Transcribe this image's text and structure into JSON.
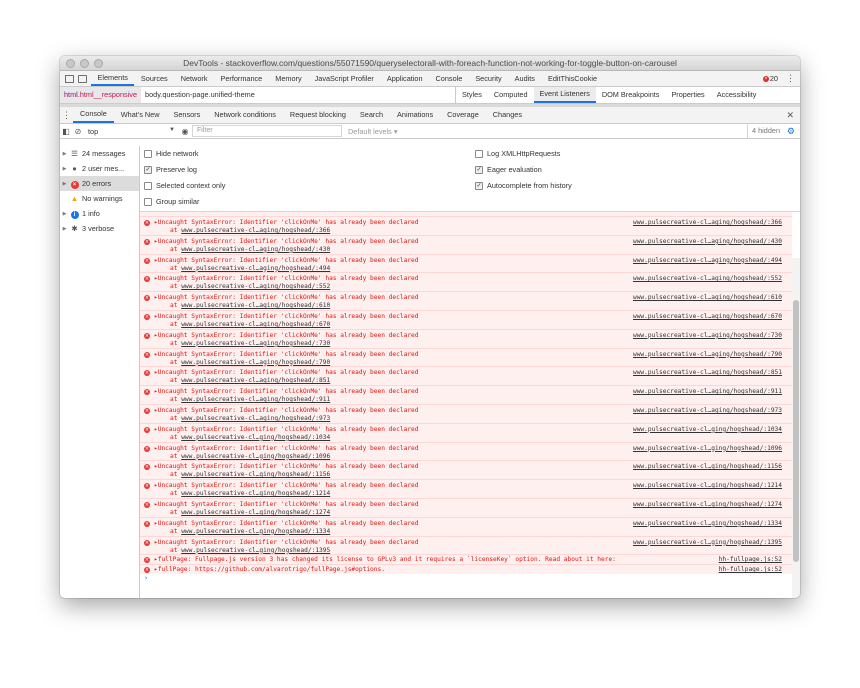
{
  "window": {
    "title": "DevTools - stackoverflow.com/questions/55071590/queryselectorall-with-foreach-function-not-working-for-toggle-button-on-carousel"
  },
  "panels": {
    "tabs": [
      "Elements",
      "Sources",
      "Network",
      "Performance",
      "Memory",
      "JavaScript Profiler",
      "Application",
      "Console",
      "Security",
      "Audits",
      "EditThisCookie"
    ],
    "selected": "Elements",
    "error_count": "20"
  },
  "elements": {
    "breadcrumb_html": "html",
    "breadcrumb_html_class": ".html__responsive",
    "breadcrumb_body": "body.question-page.unified-theme",
    "side_tabs": [
      "Styles",
      "Computed",
      "Event Listeners",
      "DOM Breakpoints",
      "Properties",
      "Accessibility"
    ],
    "side_selected": "Event Listeners"
  },
  "drawer": {
    "tabs": [
      "Console",
      "What's New",
      "Sensors",
      "Network conditions",
      "Request blocking",
      "Search",
      "Animations",
      "Coverage",
      "Changes"
    ],
    "selected": "Console"
  },
  "console_toolbar": {
    "context": "top",
    "filter_placeholder": "Filter",
    "levels": "Default levels ▾",
    "hidden": "4 hidden"
  },
  "sidebar": {
    "items": [
      {
        "label": "24 messages",
        "icon": "list-icon"
      },
      {
        "label": "2 user mes...",
        "icon": "user-icon"
      },
      {
        "label": "20 errors",
        "icon": "error-icon"
      },
      {
        "label": "No warnings",
        "icon": "warning-icon"
      },
      {
        "label": "1 info",
        "icon": "info-icon"
      },
      {
        "label": "3 verbose",
        "icon": "bug-icon"
      }
    ],
    "selected_index": 2
  },
  "settings": {
    "hide_network": "Hide network",
    "preserve_log": "Preserve log",
    "selected_context_only": "Selected context only",
    "group_similar": "Group similar",
    "log_xmlhttprequests": "Log XMLHttpRequests",
    "eager_evaluation": "Eager evaluation",
    "autocomplete_from_history": "Autocomplete from history",
    "checked": {
      "hide_network": false,
      "preserve_log": true,
      "selected_context_only": false,
      "group_similar": false,
      "log_xmlhttprequests": false,
      "eager_evaluation": true,
      "autocomplete_from_history": true
    }
  },
  "log": {
    "error_message": "▸Uncaught SyntaxError: Identifier 'clickOnMe' has already been declared",
    "at_prefix": "at",
    "errors": [
      {
        "at": "www.pulsecreative-cl…aging/hogshead/:366",
        "source": "www.pulsecreative-cl…aging/hogshead/:366"
      },
      {
        "at": "www.pulsecreative-cl…aging/hogshead/:430",
        "source": "www.pulsecreative-cl…aging/hogshead/:430"
      },
      {
        "at": "www.pulsecreative-cl…aging/hogshead/:494",
        "source": "www.pulsecreative-cl…aging/hogshead/:494"
      },
      {
        "at": "www.pulsecreative-cl…aging/hogshead/:552",
        "source": "www.pulsecreative-cl…aging/hogshead/:552"
      },
      {
        "at": "www.pulsecreative-cl…aging/hogshead/:610",
        "source": "www.pulsecreative-cl…aging/hogshead/:610"
      },
      {
        "at": "www.pulsecreative-cl…aging/hogshead/:670",
        "source": "www.pulsecreative-cl…aging/hogshead/:670"
      },
      {
        "at": "www.pulsecreative-cl…aging/hogshead/:730",
        "source": "www.pulsecreative-cl…aging/hogshead/:730"
      },
      {
        "at": "www.pulsecreative-cl…aging/hogshead/:790",
        "source": "www.pulsecreative-cl…aging/hogshead/:790"
      },
      {
        "at": "www.pulsecreative-cl…aging/hogshead/:851",
        "source": "www.pulsecreative-cl…aging/hogshead/:851"
      },
      {
        "at": "www.pulsecreative-cl…aging/hogshead/:911",
        "source": "www.pulsecreative-cl…aging/hogshead/:911"
      },
      {
        "at": "www.pulsecreative-cl…aging/hogshead/:973",
        "source": "www.pulsecreative-cl…aging/hogshead/:973"
      },
      {
        "at": "www.pulsecreative-cl…ging/hogshead/:1034",
        "source": "www.pulsecreative-cl…ging/hogshead/:1034"
      },
      {
        "at": "www.pulsecreative-cl…ging/hogshead/:1096",
        "source": "www.pulsecreative-cl…ging/hogshead/:1096"
      },
      {
        "at": "www.pulsecreative-cl…ging/hogshead/:1156",
        "source": "www.pulsecreative-cl…ging/hogshead/:1156"
      },
      {
        "at": "www.pulsecreative-cl…ging/hogshead/:1214",
        "source": "www.pulsecreative-cl…ging/hogshead/:1214"
      },
      {
        "at": "www.pulsecreative-cl…ging/hogshead/:1274",
        "source": "www.pulsecreative-cl…ging/hogshead/:1274"
      },
      {
        "at": "www.pulsecreative-cl…ging/hogshead/:1334",
        "source": "www.pulsecreative-cl…ging/hogshead/:1334"
      },
      {
        "at": "www.pulsecreative-cl…ging/hogshead/:1395",
        "source": "www.pulsecreative-cl…ging/hogshead/:1395"
      }
    ],
    "fullpage": [
      {
        "text": "▸fullPage: Fullpage.js version 3 has changed its license to GPLv3 and it requires a `licenseKey` option. Read about it here:",
        "source": "hh-fullpage.js:52"
      },
      {
        "text": "▸fullPage: https://github.com/alvarotrigo/fullPage.js#options.",
        "source": "hh-fullpage.js:52"
      }
    ],
    "prompt": "›"
  },
  "colors": {
    "accent": "#1a73e8",
    "error_text": "#e0150d",
    "error_bg": "#fff0f0"
  }
}
